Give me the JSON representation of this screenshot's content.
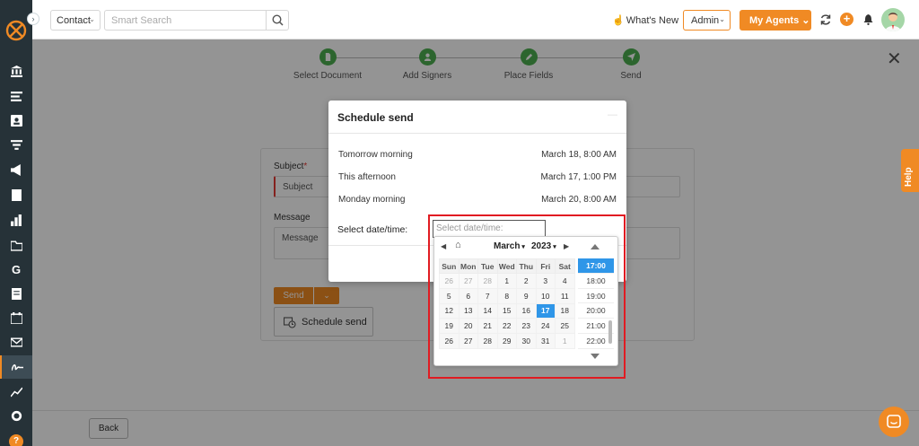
{
  "topbar": {
    "contact_label": "Contact",
    "search_placeholder": "Smart Search",
    "whats_new": "What's New",
    "admin_label": "Admin",
    "agents_label": "My Agents"
  },
  "stepper": {
    "steps": [
      {
        "label": "Select Document"
      },
      {
        "label": "Add Signers"
      },
      {
        "label": "Place Fields"
      },
      {
        "label": "Send"
      }
    ]
  },
  "form": {
    "subject_label": "Subject",
    "subject_required": "*",
    "subject_value": "Subject",
    "message_label": "Message",
    "message_value": "Message",
    "send_label": "Send",
    "schedule_send_label": "Schedule send"
  },
  "footer": {
    "back_label": "Back"
  },
  "help": {
    "label": "Help"
  },
  "modal": {
    "title": "Schedule send",
    "options": [
      {
        "label": "Tomorrow morning",
        "when": "March 18, 8:00 AM"
      },
      {
        "label": "This afternoon",
        "when": "March 17, 1:00 PM"
      },
      {
        "label": "Monday morning",
        "when": "March 20, 8:00 AM"
      }
    ],
    "select_label": "Select date/time:",
    "input_placeholder": "Select date/time:"
  },
  "picker": {
    "month": "March",
    "year": "2023",
    "weekdays": [
      "Sun",
      "Mon",
      "Tue",
      "Wed",
      "Thu",
      "Fri",
      "Sat"
    ],
    "weeks": [
      [
        "26",
        "27",
        "28",
        "1",
        "2",
        "3",
        "4"
      ],
      [
        "5",
        "6",
        "7",
        "8",
        "9",
        "10",
        "11"
      ],
      [
        "12",
        "13",
        "14",
        "15",
        "16",
        "17",
        "18"
      ],
      [
        "19",
        "20",
        "21",
        "22",
        "23",
        "24",
        "25"
      ],
      [
        "26",
        "27",
        "28",
        "29",
        "30",
        "31",
        "1"
      ]
    ],
    "selected_day": "17",
    "times": [
      "17:00",
      "18:00",
      "19:00",
      "20:00",
      "21:00",
      "22:00"
    ],
    "selected_time": "17:00"
  },
  "colors": {
    "accent": "#f08a24",
    "sidebar": "#263238",
    "step_done": "#4caf50",
    "selected": "#2f96e8",
    "highlight": "#e11b22"
  }
}
